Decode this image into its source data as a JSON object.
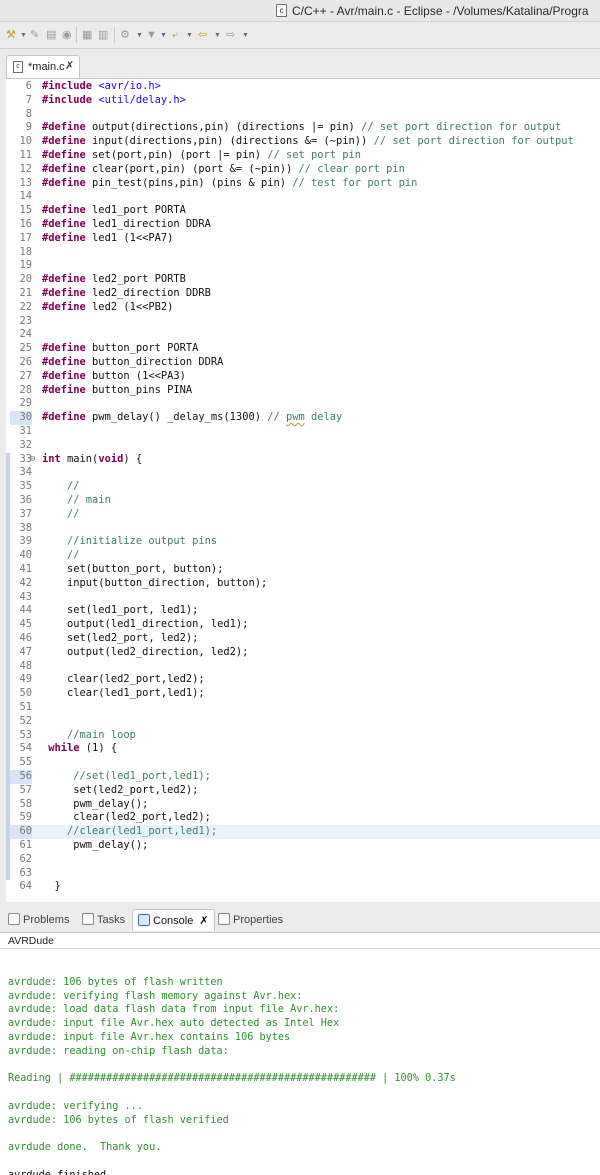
{
  "window": {
    "title": "C/C++ - Avr/main.c - Eclipse - /Volumes/Katalina/Progra"
  },
  "toolbar": {
    "icons": [
      "tools-icon",
      "pencil-icon",
      "print-icon",
      "save-icon",
      "copy-icon",
      "build-icon",
      "arrow-back-icon",
      "arrow-forward-icon"
    ]
  },
  "editor": {
    "tab_label": "*main.c",
    "lines": [
      {
        "n": "6",
        "t": "#include <avr/io.h>"
      },
      {
        "n": "7",
        "t": "#include <util/delay.h>"
      },
      {
        "n": "8",
        "t": ""
      },
      {
        "n": "9",
        "t": "#define output(directions,pin) (directions |= pin) // set port direction for output"
      },
      {
        "n": "10",
        "t": "#define input(directions,pin) (directions &= (~pin)) // set port direction for output"
      },
      {
        "n": "11",
        "t": "#define set(port,pin) (port |= pin) // set port pin"
      },
      {
        "n": "12",
        "t": "#define clear(port,pin) (port &= (~pin)) // clear port pin"
      },
      {
        "n": "13",
        "t": "#define pin_test(pins,pin) (pins & pin) // test for port pin"
      },
      {
        "n": "14",
        "t": ""
      },
      {
        "n": "15",
        "t": "#define led1_port PORTA"
      },
      {
        "n": "16",
        "t": "#define led1_direction DDRA"
      },
      {
        "n": "17",
        "t": "#define led1 (1<<PA7)"
      },
      {
        "n": "18",
        "t": ""
      },
      {
        "n": "19",
        "t": ""
      },
      {
        "n": "20",
        "t": "#define led2_port PORTB"
      },
      {
        "n": "21",
        "t": "#define led2_direction DDRB"
      },
      {
        "n": "22",
        "t": "#define led2 (1<<PB2)"
      },
      {
        "n": "23",
        "t": ""
      },
      {
        "n": "24",
        "t": ""
      },
      {
        "n": "25",
        "t": "#define button_port PORTA"
      },
      {
        "n": "26",
        "t": "#define button_direction DDRA"
      },
      {
        "n": "27",
        "t": "#define button (1<<PA3)"
      },
      {
        "n": "28",
        "t": "#define button_pins PINA"
      },
      {
        "n": "29",
        "t": ""
      },
      {
        "n": "30",
        "t": "#define pwm_delay() _delay_ms(1300) // pwm delay"
      },
      {
        "n": "31",
        "t": ""
      },
      {
        "n": "32",
        "t": ""
      },
      {
        "n": "33",
        "t": "int main(void) {"
      },
      {
        "n": "34",
        "t": ""
      },
      {
        "n": "35",
        "t": "    //"
      },
      {
        "n": "36",
        "t": "    // main"
      },
      {
        "n": "37",
        "t": "    //"
      },
      {
        "n": "38",
        "t": ""
      },
      {
        "n": "39",
        "t": "    //initialize output pins"
      },
      {
        "n": "40",
        "t": "    //"
      },
      {
        "n": "41",
        "t": "    set(button_port, button);"
      },
      {
        "n": "42",
        "t": "    input(button_direction, button);"
      },
      {
        "n": "43",
        "t": ""
      },
      {
        "n": "44",
        "t": "    set(led1_port, led1);"
      },
      {
        "n": "45",
        "t": "    output(led1_direction, led1);"
      },
      {
        "n": "46",
        "t": "    set(led2_port, led2);"
      },
      {
        "n": "47",
        "t": "    output(led2_direction, led2);"
      },
      {
        "n": "48",
        "t": ""
      },
      {
        "n": "49",
        "t": "    clear(led2_port,led2);"
      },
      {
        "n": "50",
        "t": "    clear(led1_port,led1);"
      },
      {
        "n": "51",
        "t": ""
      },
      {
        "n": "52",
        "t": ""
      },
      {
        "n": "53",
        "t": "    //main loop"
      },
      {
        "n": "54",
        "t": " while (1) {"
      },
      {
        "n": "55",
        "t": ""
      },
      {
        "n": "56",
        "t": "     //set(led1_port,led1);"
      },
      {
        "n": "57",
        "t": "     set(led2_port,led2);"
      },
      {
        "n": "58",
        "t": "     pwm_delay();"
      },
      {
        "n": "59",
        "t": "     clear(led2_port,led2);"
      },
      {
        "n": "60",
        "t": "    //clear(led1_port,led1);"
      },
      {
        "n": "61",
        "t": "     pwm_delay();"
      },
      {
        "n": "62",
        "t": ""
      },
      {
        "n": "63",
        "t": ""
      },
      {
        "n": "64",
        "t": "  }"
      }
    ]
  },
  "panel": {
    "tabs": [
      {
        "label": "Problems",
        "icon": "problems-icon"
      },
      {
        "label": "Tasks",
        "icon": "tasks-icon"
      },
      {
        "label": "Console",
        "icon": "console-icon"
      },
      {
        "label": "Properties",
        "icon": "properties-icon"
      }
    ],
    "console_title": "AVRDude",
    "console_lines": [
      "",
      "avrdude: 106 bytes of flash written",
      "avrdude: verifying flash memory against Avr.hex:",
      "avrdude: load data flash data from input file Avr.hex:",
      "avrdude: input file Avr.hex auto detected as Intel Hex",
      "avrdude: input file Avr.hex contains 106 bytes",
      "avrdude: reading on-chip flash data:",
      "",
      "Reading | ################################################## | 100% 0.37s",
      "",
      "avrdude: verifying ...",
      "avrdude: 106 bytes of flash verified",
      "",
      "avrdude done.  Thank you.",
      "",
      "avrdude finished"
    ]
  }
}
